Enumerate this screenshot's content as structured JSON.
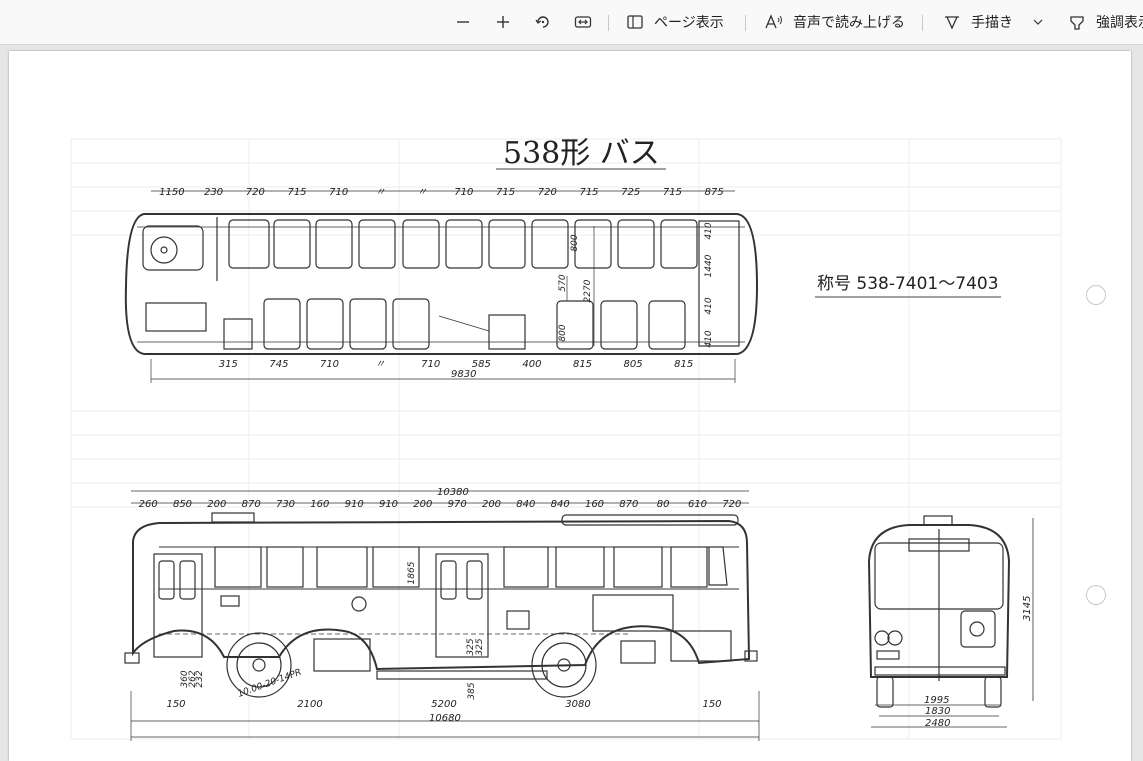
{
  "toolbar": {
    "page_view_label": "ページ表示",
    "read_aloud_label": "音声で読み上げる",
    "draw_label": "手描き",
    "highlight_label": "強調表示"
  },
  "document": {
    "title": "538形 バス",
    "designation": "称号 538-7401～7403",
    "plan_dims_top": [
      "1150",
      "230",
      "720",
      "715",
      "710",
      "〃",
      "〃",
      "710",
      "715",
      "720",
      "715",
      "725",
      "715",
      "875"
    ],
    "plan_dims_bottom": [
      "315",
      "745",
      "710",
      "〃",
      "710",
      "585",
      "400",
      "815",
      "805",
      "815"
    ],
    "plan_total_length": "9830",
    "plan_interior_labels": [
      "800",
      "570",
      "2270",
      "800",
      "410",
      "1440",
      "410",
      "410"
    ],
    "side_dims_top": [
      "260",
      "850",
      "200",
      "870",
      "730",
      "160",
      "910",
      "910",
      "200",
      "970",
      "200",
      "840",
      "840",
      "160",
      "870",
      "80",
      "610",
      "720"
    ],
    "side_overall_top": "10380",
    "side_vertical_labels": [
      "1865",
      "325",
      "325",
      "360",
      "385",
      "262",
      "232"
    ],
    "tire_label": "10.00-20-14PR",
    "side_dims_bottom": [
      "150",
      "2100",
      "5200",
      "3080",
      "150"
    ],
    "side_total_length": "10680",
    "front_height": "3145",
    "front_widths": [
      "1995",
      "1830",
      "2480"
    ]
  }
}
